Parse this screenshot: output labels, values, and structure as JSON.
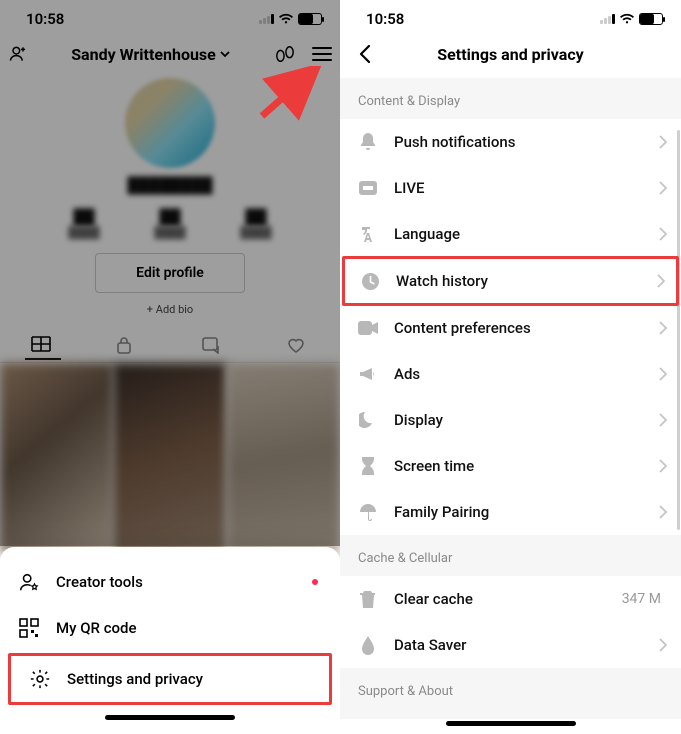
{
  "statusbar": {
    "time": "10:58"
  },
  "left": {
    "profile_name": "Sandy Writtenhouse",
    "edit_profile": "Edit profile",
    "add_bio": "+ Add bio",
    "sheet": [
      {
        "label": "Creator tools",
        "has_dot": true
      },
      {
        "label": "My QR code"
      },
      {
        "label": "Settings and privacy"
      }
    ]
  },
  "right": {
    "title": "Settings and privacy",
    "sections": [
      {
        "label": "Content & Display",
        "items": [
          {
            "icon": "bell",
            "label": "Push notifications"
          },
          {
            "icon": "live",
            "label": "LIVE"
          },
          {
            "icon": "language",
            "label": "Language"
          },
          {
            "icon": "clock",
            "label": "Watch history",
            "highlight": true
          },
          {
            "icon": "video",
            "label": "Content preferences"
          },
          {
            "icon": "megaphone",
            "label": "Ads"
          },
          {
            "icon": "moon",
            "label": "Display"
          },
          {
            "icon": "hourglass",
            "label": "Screen time"
          },
          {
            "icon": "umbrella",
            "label": "Family Pairing"
          }
        ]
      },
      {
        "label": "Cache & Cellular",
        "items": [
          {
            "icon": "trash",
            "label": "Clear cache",
            "value": "347 M"
          },
          {
            "icon": "drop",
            "label": "Data Saver"
          }
        ]
      },
      {
        "label": "Support & About",
        "items": []
      }
    ]
  }
}
